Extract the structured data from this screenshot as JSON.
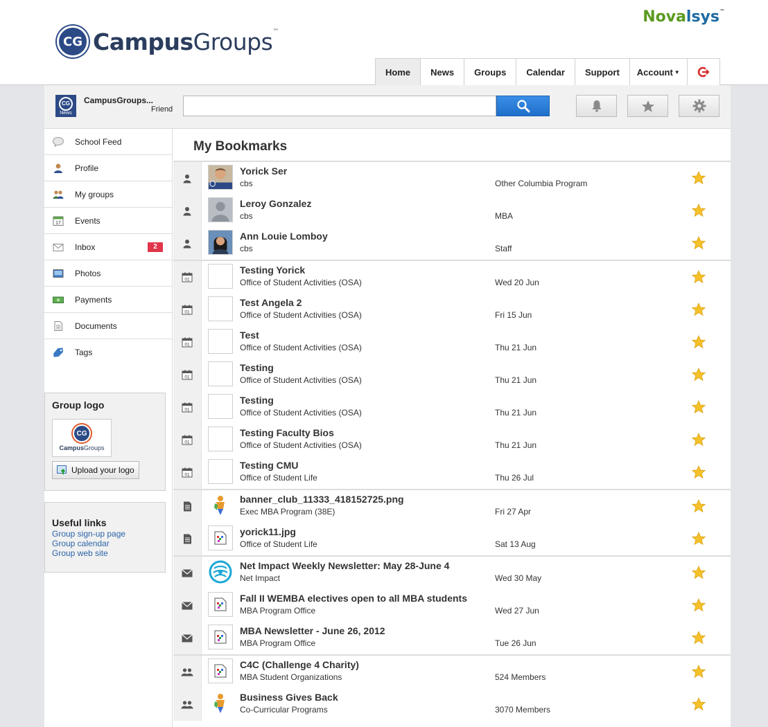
{
  "header": {
    "brand_primary": "Campus",
    "brand_secondary": "Groups",
    "brand_tm": "™",
    "logo_badge": "CG",
    "partner_a": "Nova",
    "partner_b": "lsys",
    "partner_tm": "™"
  },
  "topnav": {
    "tabs": [
      "Home",
      "News",
      "Groups",
      "Calendar",
      "Support",
      "Account"
    ],
    "active": "Home"
  },
  "toolbar": {
    "avatar_badge": "CG",
    "avatar_caption": "News",
    "user_name": "CampusGroups...",
    "user_role": "Friend",
    "search_value": "",
    "search_placeholder": ""
  },
  "sidebar": {
    "items": [
      {
        "label": "School Feed",
        "icon": "speech-bubble-icon"
      },
      {
        "label": "Profile",
        "icon": "person-icon"
      },
      {
        "label": "My groups",
        "icon": "people-icon"
      },
      {
        "label": "Events",
        "icon": "calendar-icon"
      },
      {
        "label": "Inbox",
        "icon": "envelope-icon",
        "badge": "2"
      },
      {
        "label": "Photos",
        "icon": "photo-icon"
      },
      {
        "label": "Payments",
        "icon": "money-icon"
      },
      {
        "label": "Documents",
        "icon": "document-icon"
      },
      {
        "label": "Tags",
        "icon": "tag-icon"
      }
    ],
    "group_logo": {
      "heading": "Group logo",
      "preview_text_campus": "Campus",
      "preview_text_groups": "Groups",
      "preview_badge": "CG",
      "upload_label": "Upload your logo"
    },
    "useful_links": {
      "heading": "Useful links",
      "links": [
        "Group sign-up page",
        "Group calendar",
        "Group web site"
      ]
    }
  },
  "main": {
    "title": "My Bookmarks",
    "groups": [
      {
        "type": "person",
        "rows": [
          {
            "title": "Yorick Ser",
            "sub": "cbs",
            "meta": "Other Columbia Program",
            "thumb": "photo-yorick",
            "thumb_caption": "Yorick"
          },
          {
            "title": "Leroy Gonzalez",
            "sub": "cbs",
            "meta": "MBA",
            "thumb": "photo-placeholder"
          },
          {
            "title": "Ann Louie Lomboy",
            "sub": "cbs",
            "meta": "Staff",
            "thumb": "photo-ann"
          }
        ]
      },
      {
        "type": "event",
        "rows": [
          {
            "title": "Testing Yorick",
            "sub": "Office of Student Activities (OSA)",
            "meta": "Wed 20 Jun",
            "thumb": "blank"
          },
          {
            "title": "Test Angela 2",
            "sub": "Office of Student Activities (OSA)",
            "meta": "Fri 15 Jun",
            "thumb": "blank"
          },
          {
            "title": "Test",
            "sub": "Office of Student Activities (OSA)",
            "meta": "Thu 21 Jun",
            "thumb": "blank"
          },
          {
            "title": "Testing",
            "sub": "Office of Student Activities (OSA)",
            "meta": "Thu 21 Jun",
            "thumb": "blank"
          },
          {
            "title": "Testing",
            "sub": "Office of Student Activities (OSA)",
            "meta": "Thu 21 Jun",
            "thumb": "blank"
          },
          {
            "title": "Testing Faculty Bios",
            "sub": "Office of Student Activities (OSA)",
            "meta": "Thu 21 Jun",
            "thumb": "blank"
          },
          {
            "title": "Testing CMU",
            "sub": "Office of Student Life",
            "meta": "Thu 26 Jul",
            "thumb": "blank"
          }
        ]
      },
      {
        "type": "document",
        "rows": [
          {
            "title": "banner_club_11333_418152725.png",
            "sub": "Exec MBA Program (38E)",
            "meta": "Fri 27 Apr",
            "thumb": "figure-icon"
          },
          {
            "title": "yorick11.jpg",
            "sub": "Office of Student Life",
            "meta": "Sat 13 Aug",
            "thumb": "broken-image-icon"
          }
        ]
      },
      {
        "type": "newsletter",
        "rows": [
          {
            "title": "Net Impact Weekly Newsletter: May 28-June 4",
            "sub": "Net Impact",
            "meta": "Wed 30 May",
            "thumb": "globe-logo"
          },
          {
            "title": "Fall II WEMBA electives open to all MBA students",
            "sub": "MBA Program Office",
            "meta": "Wed 27 Jun",
            "thumb": "broken-image-icon"
          },
          {
            "title": "MBA Newsletter - June 26, 2012",
            "sub": "MBA Program Office",
            "meta": "Tue 26 Jun",
            "thumb": "broken-image-icon"
          }
        ]
      },
      {
        "type": "group",
        "rows": [
          {
            "title": "C4C (Challenge 4 Charity)",
            "sub": "MBA Student Organizations",
            "meta": "524 Members",
            "thumb": "broken-image-icon"
          },
          {
            "title": "Business Gives Back",
            "sub": "Co-Curricular Programs",
            "meta": "3070 Members",
            "thumb": "figure-icon"
          }
        ]
      }
    ]
  },
  "colors": {
    "accent_blue": "#1f6fc9",
    "star_gold": "#f5c02a",
    "badge_red": "#e0354a",
    "link_blue": "#2a63a8",
    "nova_green": "#5b9a1f"
  }
}
